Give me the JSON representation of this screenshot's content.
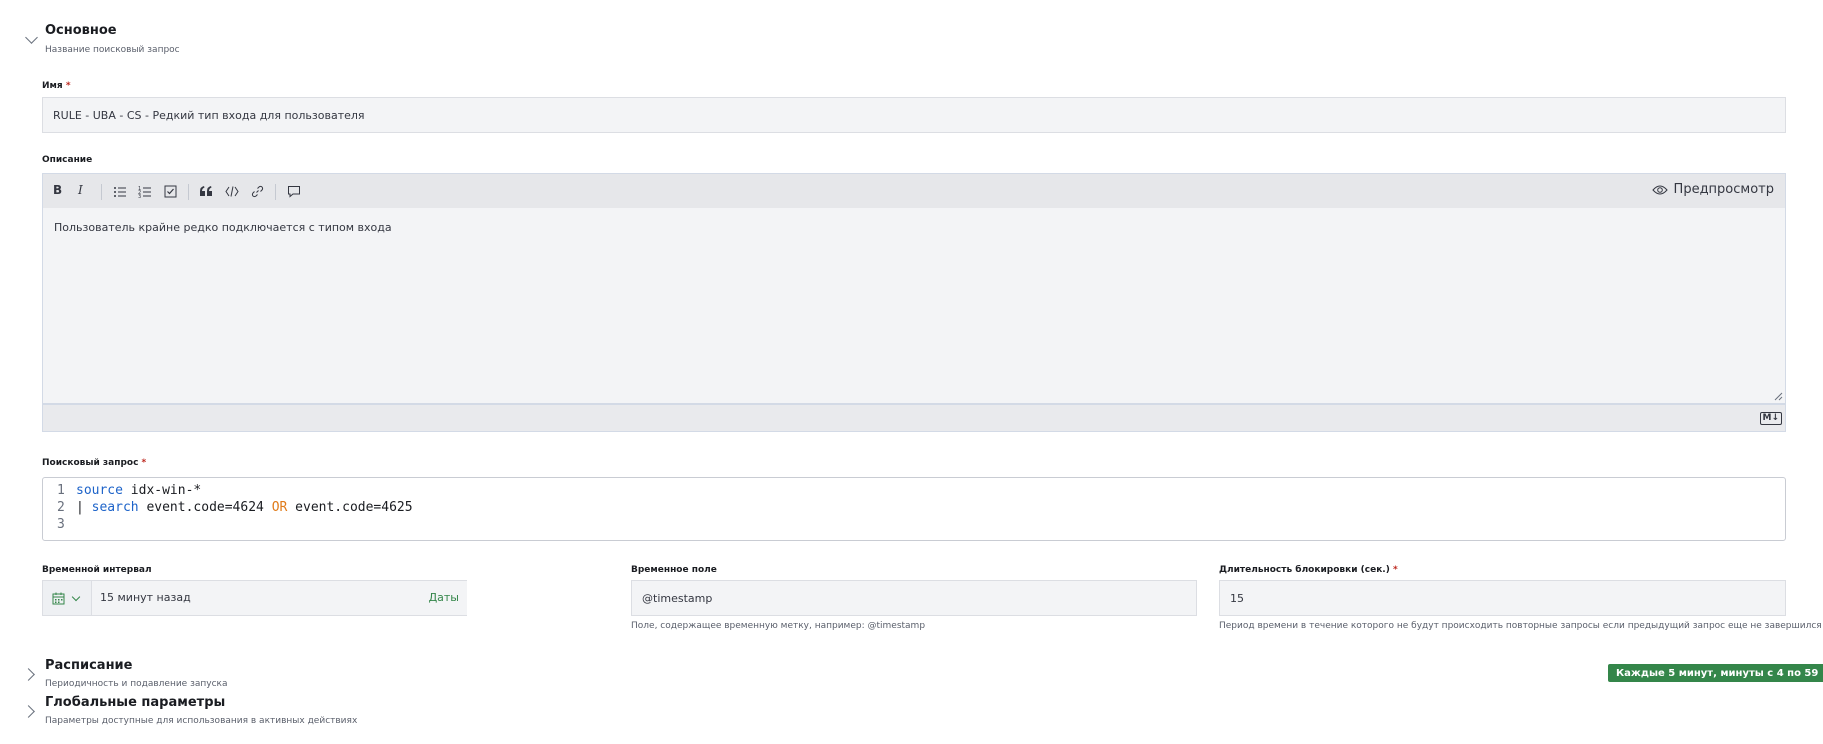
{
  "general": {
    "title": "Основное",
    "subtitle": "Название поисковый запрос",
    "name_label": "Имя",
    "name_value": "RULE - UBA - CS - Редкий тип входа для пользователя",
    "description_label": "Описание",
    "toolbar": {
      "bold": "B",
      "italic": "I",
      "preview_label": "Предпросмотр"
    },
    "description_value": "Пользователь крайне редко подключается с типом входа",
    "markdown_badge": "M↓",
    "query_label": "Поисковый запрос",
    "query_lines": {
      "n1": "1",
      "n2": "2",
      "n3": "3",
      "l1_kw": "source",
      "l1_rest": " idx-win-*",
      "l2_pipe": "| ",
      "l2_kw": "search",
      "l2_a": " event.code=4624 ",
      "l2_op": "OR",
      "l2_b": " event.code=4625"
    },
    "interval_label": "Временной интервал",
    "interval_value": "15 минут назад",
    "interval_dates": "Даты",
    "time_field_label": "Временное поле",
    "time_field_value": "@timestamp",
    "time_field_hint": "Поле, содержащее временную метку, например: @timestamp",
    "block_label": "Длительность блокировки (сек.)",
    "block_value": "15",
    "block_hint": "Период времени в течение которого не будут происходить повторные запросы если предыдущий запрос еще не завершился",
    "required_mark": "*"
  },
  "schedule": {
    "title": "Расписание",
    "subtitle": "Периодичность и подавление запуска",
    "badge": "Каждые 5 минут, минуты с 4 по 59"
  },
  "global_params": {
    "title": "Глобальные параметры",
    "subtitle": "Параметры доступные для использования в активных действиях"
  },
  "colors": {
    "accent_green": "#34864a",
    "keyword_blue": "#1d63c9",
    "operator_orange": "#e07b1a",
    "required_red": "#bd271e"
  }
}
